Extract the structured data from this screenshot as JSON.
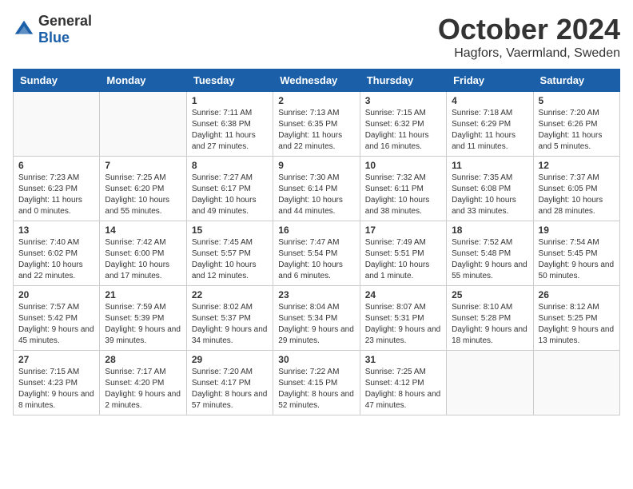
{
  "logo": {
    "text_general": "General",
    "text_blue": "Blue"
  },
  "title": "October 2024",
  "location": "Hagfors, Vaermland, Sweden",
  "weekdays": [
    "Sunday",
    "Monday",
    "Tuesday",
    "Wednesday",
    "Thursday",
    "Friday",
    "Saturday"
  ],
  "weeks": [
    [
      {
        "day": "",
        "empty": true
      },
      {
        "day": "",
        "empty": true
      },
      {
        "day": "1",
        "sunrise": "Sunrise: 7:11 AM",
        "sunset": "Sunset: 6:38 PM",
        "daylight": "Daylight: 11 hours and 27 minutes."
      },
      {
        "day": "2",
        "sunrise": "Sunrise: 7:13 AM",
        "sunset": "Sunset: 6:35 PM",
        "daylight": "Daylight: 11 hours and 22 minutes."
      },
      {
        "day": "3",
        "sunrise": "Sunrise: 7:15 AM",
        "sunset": "Sunset: 6:32 PM",
        "daylight": "Daylight: 11 hours and 16 minutes."
      },
      {
        "day": "4",
        "sunrise": "Sunrise: 7:18 AM",
        "sunset": "Sunset: 6:29 PM",
        "daylight": "Daylight: 11 hours and 11 minutes."
      },
      {
        "day": "5",
        "sunrise": "Sunrise: 7:20 AM",
        "sunset": "Sunset: 6:26 PM",
        "daylight": "Daylight: 11 hours and 5 minutes."
      }
    ],
    [
      {
        "day": "6",
        "sunrise": "Sunrise: 7:23 AM",
        "sunset": "Sunset: 6:23 PM",
        "daylight": "Daylight: 11 hours and 0 minutes."
      },
      {
        "day": "7",
        "sunrise": "Sunrise: 7:25 AM",
        "sunset": "Sunset: 6:20 PM",
        "daylight": "Daylight: 10 hours and 55 minutes."
      },
      {
        "day": "8",
        "sunrise": "Sunrise: 7:27 AM",
        "sunset": "Sunset: 6:17 PM",
        "daylight": "Daylight: 10 hours and 49 minutes."
      },
      {
        "day": "9",
        "sunrise": "Sunrise: 7:30 AM",
        "sunset": "Sunset: 6:14 PM",
        "daylight": "Daylight: 10 hours and 44 minutes."
      },
      {
        "day": "10",
        "sunrise": "Sunrise: 7:32 AM",
        "sunset": "Sunset: 6:11 PM",
        "daylight": "Daylight: 10 hours and 38 minutes."
      },
      {
        "day": "11",
        "sunrise": "Sunrise: 7:35 AM",
        "sunset": "Sunset: 6:08 PM",
        "daylight": "Daylight: 10 hours and 33 minutes."
      },
      {
        "day": "12",
        "sunrise": "Sunrise: 7:37 AM",
        "sunset": "Sunset: 6:05 PM",
        "daylight": "Daylight: 10 hours and 28 minutes."
      }
    ],
    [
      {
        "day": "13",
        "sunrise": "Sunrise: 7:40 AM",
        "sunset": "Sunset: 6:02 PM",
        "daylight": "Daylight: 10 hours and 22 minutes."
      },
      {
        "day": "14",
        "sunrise": "Sunrise: 7:42 AM",
        "sunset": "Sunset: 6:00 PM",
        "daylight": "Daylight: 10 hours and 17 minutes."
      },
      {
        "day": "15",
        "sunrise": "Sunrise: 7:45 AM",
        "sunset": "Sunset: 5:57 PM",
        "daylight": "Daylight: 10 hours and 12 minutes."
      },
      {
        "day": "16",
        "sunrise": "Sunrise: 7:47 AM",
        "sunset": "Sunset: 5:54 PM",
        "daylight": "Daylight: 10 hours and 6 minutes."
      },
      {
        "day": "17",
        "sunrise": "Sunrise: 7:49 AM",
        "sunset": "Sunset: 5:51 PM",
        "daylight": "Daylight: 10 hours and 1 minute."
      },
      {
        "day": "18",
        "sunrise": "Sunrise: 7:52 AM",
        "sunset": "Sunset: 5:48 PM",
        "daylight": "Daylight: 9 hours and 55 minutes."
      },
      {
        "day": "19",
        "sunrise": "Sunrise: 7:54 AM",
        "sunset": "Sunset: 5:45 PM",
        "daylight": "Daylight: 9 hours and 50 minutes."
      }
    ],
    [
      {
        "day": "20",
        "sunrise": "Sunrise: 7:57 AM",
        "sunset": "Sunset: 5:42 PM",
        "daylight": "Daylight: 9 hours and 45 minutes."
      },
      {
        "day": "21",
        "sunrise": "Sunrise: 7:59 AM",
        "sunset": "Sunset: 5:39 PM",
        "daylight": "Daylight: 9 hours and 39 minutes."
      },
      {
        "day": "22",
        "sunrise": "Sunrise: 8:02 AM",
        "sunset": "Sunset: 5:37 PM",
        "daylight": "Daylight: 9 hours and 34 minutes."
      },
      {
        "day": "23",
        "sunrise": "Sunrise: 8:04 AM",
        "sunset": "Sunset: 5:34 PM",
        "daylight": "Daylight: 9 hours and 29 minutes."
      },
      {
        "day": "24",
        "sunrise": "Sunrise: 8:07 AM",
        "sunset": "Sunset: 5:31 PM",
        "daylight": "Daylight: 9 hours and 23 minutes."
      },
      {
        "day": "25",
        "sunrise": "Sunrise: 8:10 AM",
        "sunset": "Sunset: 5:28 PM",
        "daylight": "Daylight: 9 hours and 18 minutes."
      },
      {
        "day": "26",
        "sunrise": "Sunrise: 8:12 AM",
        "sunset": "Sunset: 5:25 PM",
        "daylight": "Daylight: 9 hours and 13 minutes."
      }
    ],
    [
      {
        "day": "27",
        "sunrise": "Sunrise: 7:15 AM",
        "sunset": "Sunset: 4:23 PM",
        "daylight": "Daylight: 9 hours and 8 minutes."
      },
      {
        "day": "28",
        "sunrise": "Sunrise: 7:17 AM",
        "sunset": "Sunset: 4:20 PM",
        "daylight": "Daylight: 9 hours and 2 minutes."
      },
      {
        "day": "29",
        "sunrise": "Sunrise: 7:20 AM",
        "sunset": "Sunset: 4:17 PM",
        "daylight": "Daylight: 8 hours and 57 minutes."
      },
      {
        "day": "30",
        "sunrise": "Sunrise: 7:22 AM",
        "sunset": "Sunset: 4:15 PM",
        "daylight": "Daylight: 8 hours and 52 minutes."
      },
      {
        "day": "31",
        "sunrise": "Sunrise: 7:25 AM",
        "sunset": "Sunset: 4:12 PM",
        "daylight": "Daylight: 8 hours and 47 minutes."
      },
      {
        "day": "",
        "empty": true
      },
      {
        "day": "",
        "empty": true
      }
    ]
  ]
}
